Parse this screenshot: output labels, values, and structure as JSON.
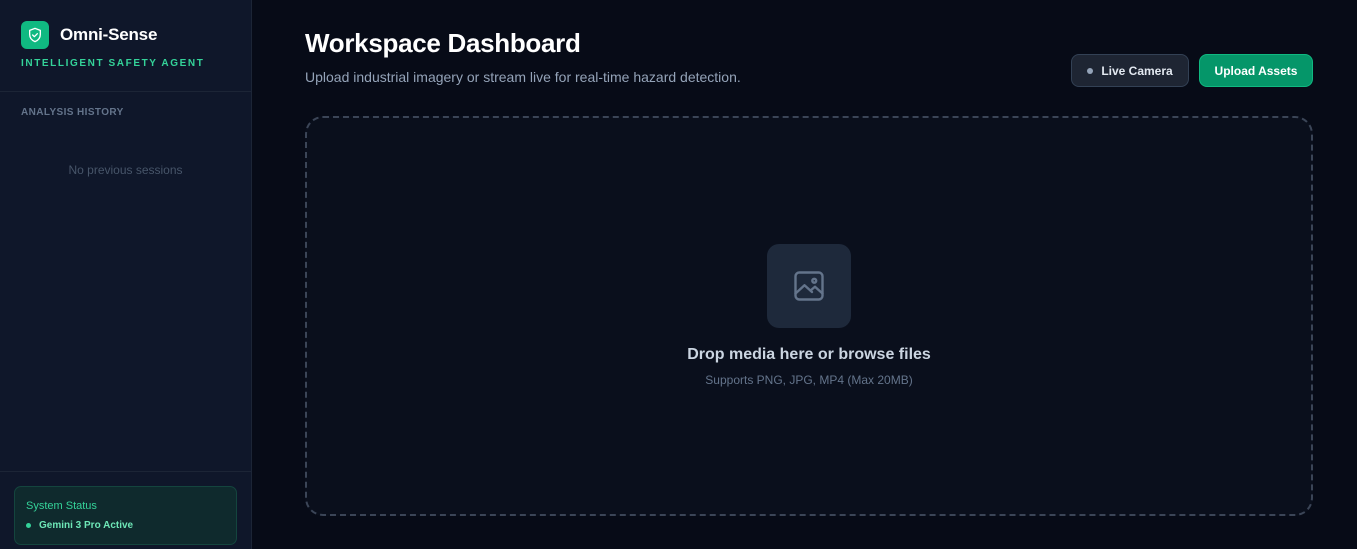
{
  "sidebar": {
    "brand_name": "Omni-Sense",
    "brand_tagline": "INTELLIGENT SAFETY AGENT",
    "brand_icon": "shield-check-icon",
    "history_label": "ANALYSIS HISTORY",
    "history_empty": "No previous sessions",
    "status": {
      "title": "System Status",
      "text": "Gemini 3 Pro Active"
    }
  },
  "main": {
    "title": "Workspace Dashboard",
    "subtitle": "Upload industrial imagery or stream live for real-time hazard detection.",
    "live_camera_label": "Live Camera",
    "upload_label": "Upload Assets",
    "dropzone": {
      "icon": "image-icon",
      "title": "Drop media here or browse files",
      "hint": "Supports PNG, JPG, MP4 (Max 20MB)"
    }
  },
  "colors": {
    "accent": "#10b981",
    "background": "#070b17",
    "sidebar": "#0f172a"
  }
}
